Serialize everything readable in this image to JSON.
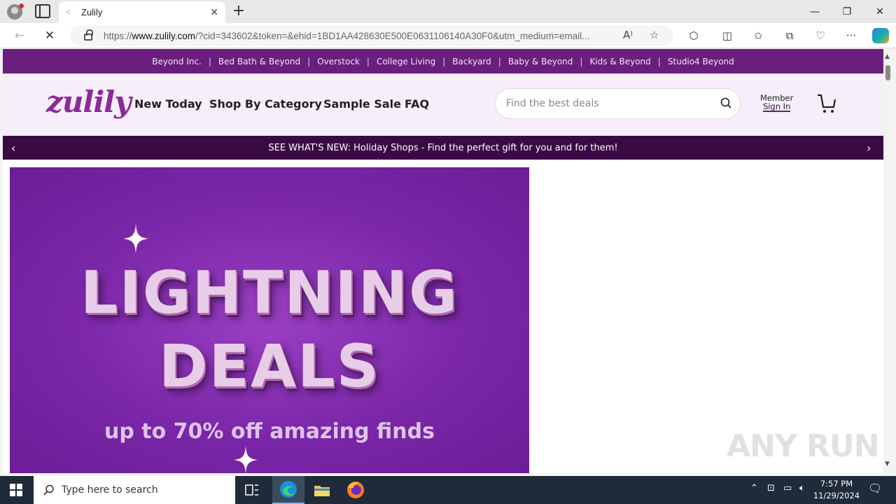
{
  "browser": {
    "tab_title": "Zulily",
    "url_prefix": "https://",
    "url_domain": "www.zulily.com",
    "url_rest": "/?cid=343602&token=&ehid=1BD1AA428630E500E0631106140A30F0&utm_medium=email...",
    "icons": [
      "profile-icon",
      "tab-actions-icon",
      "close-icon",
      "new-tab-icon",
      "back-icon",
      "stop-loading-icon",
      "lock-icon",
      "read-aloud-icon",
      "favorite-star-icon",
      "extensions-icon",
      "split-screen-icon",
      "favorites-icon",
      "collections-icon",
      "browser-essentials-icon",
      "more-icon",
      "copilot-icon"
    ]
  },
  "site": {
    "top_links": [
      "Beyond Inc.",
      "Bed Bath & Beyond",
      "Overstock",
      "College Living",
      "Backyard",
      "Baby & Beyond",
      "Kids & Beyond",
      "Studio4 Beyond"
    ],
    "logo": "zulily",
    "nav": {
      "new_today": "New Today",
      "shop_by_category": "Shop By Category",
      "sample_sale": "Sample Sale",
      "faq": "FAQ"
    },
    "search_placeholder": "Find the best deals",
    "member_label": "Member",
    "sign_in_label": "Sign In",
    "promo_text": "SEE WHAT'S NEW: Holiday Shops - Find the perfect gift for you and for them!",
    "hero": {
      "line1": "LIGHTNING",
      "line2": "DEALS",
      "subtitle": "up to 70% off amazing finds"
    },
    "colors": {
      "brand_purple": "#6b1e7e",
      "header_bg": "#f6eef9",
      "promo_bg": "#3a0a45",
      "hero_bg": "#7a26a8"
    }
  },
  "watermark": "ANY RUN",
  "taskbar": {
    "search_placeholder": "Type here to search",
    "time": "7:57 PM",
    "date": "11/29/2024"
  }
}
